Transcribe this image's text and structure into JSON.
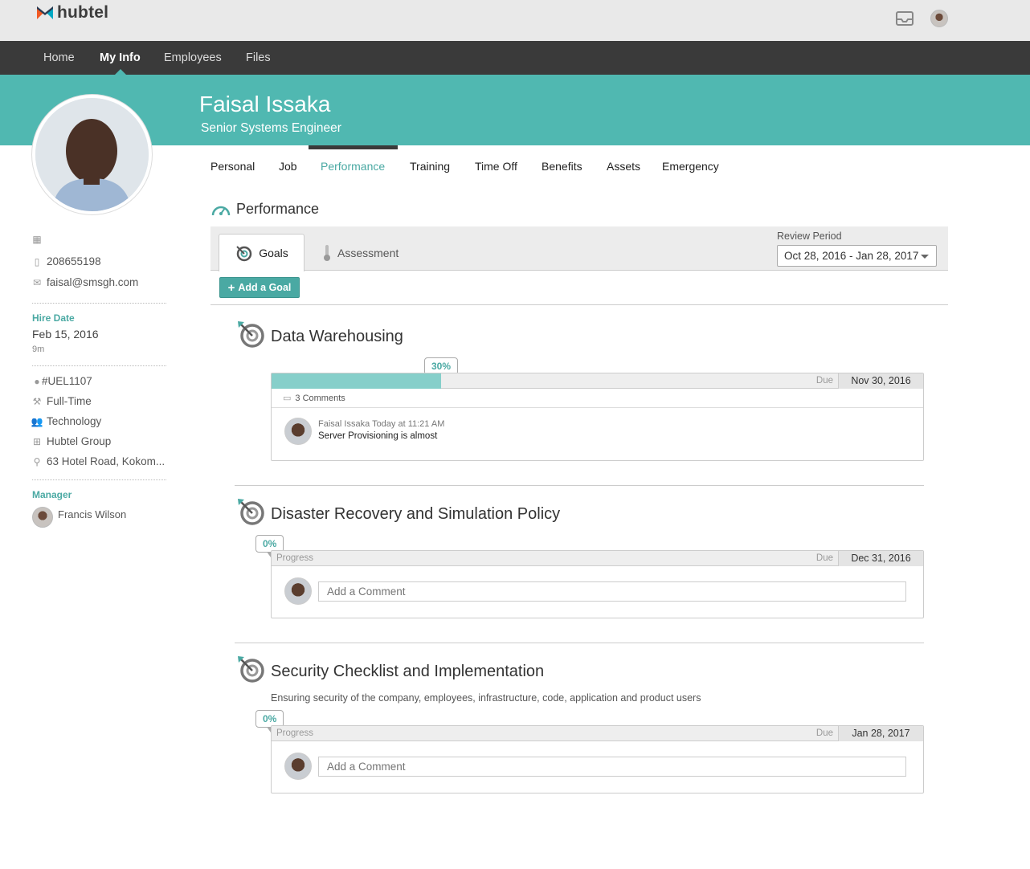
{
  "app": {
    "brand": "hubtel",
    "accent": "#50b8b1",
    "nav_bg": "#3a3a3a"
  },
  "top": {
    "icons": [
      "inbox-icon",
      "user-avatar"
    ]
  },
  "nav": {
    "items": [
      "Home",
      "My Info",
      "Employees",
      "Files"
    ],
    "active": "My Info"
  },
  "employee": {
    "name": "Faisal Issaka",
    "title": "Senior Systems Engineer"
  },
  "sidebar": {
    "phone": "208655198",
    "email": "faisal@smsgh.com",
    "hire_label": "Hire Date",
    "hire_date": "Feb 15, 2016",
    "tenure": "9m",
    "emp_id": "UEL1107",
    "emp_id_prefix": "#",
    "employment_type": "Full-Time",
    "department": "Technology",
    "company": "Hubtel Group",
    "location": "63 Hotel Road, Kokom...",
    "manager_label": "Manager",
    "manager": "Francis Wilson"
  },
  "tabs": [
    "Personal",
    "Job",
    "Performance",
    "Training",
    "Time Off",
    "Benefits",
    "Assets",
    "Emergency"
  ],
  "tabs_active": "Performance",
  "performance": {
    "title": "Performance",
    "subtab_goals": "Goals",
    "subtab_assessment": "Assessment",
    "review_label": "Review Period",
    "review_value": "Oct 28, 2016 - Jan 28, 2017",
    "add_goal": "Add a Goal",
    "progress_label": "Progress",
    "due_label": "Due",
    "comment_placeholder": "Add a Comment"
  },
  "goals": [
    {
      "title": "Data Warehousing",
      "progress_text": "30%",
      "progress": 0.3,
      "due": "Nov 30, 2016",
      "comments_count": "3 Comments",
      "comment_author": "Faisal Issaka",
      "comment_time": "Today at 11:21 AM",
      "comment_text": "Server Provisioning is almost"
    },
    {
      "title": "Disaster Recovery and Simulation Policy",
      "progress_text": "0%",
      "progress": 0,
      "due": "Dec 31, 2016"
    },
    {
      "title": "Security Checklist and Implementation",
      "description": "Ensuring security of the company, employees, infrastructure, code, application and product users",
      "progress_text": "0%",
      "progress": 0,
      "due": "Jan 28, 2017"
    }
  ]
}
